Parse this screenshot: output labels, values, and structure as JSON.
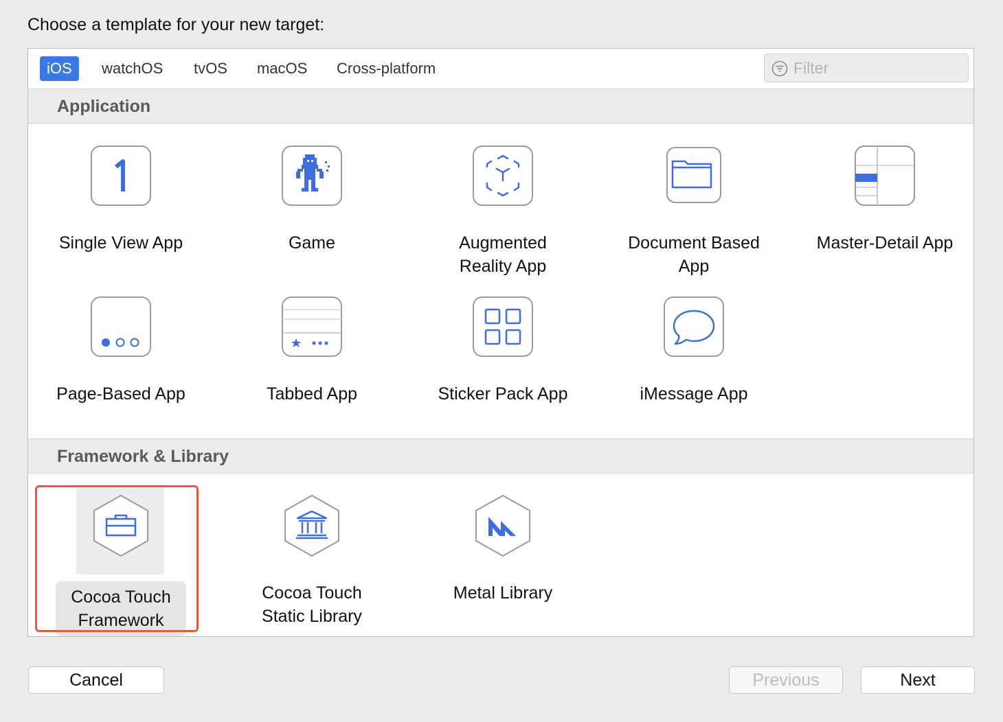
{
  "dialog": {
    "heading": "Choose a template for your new target:"
  },
  "tabs": [
    {
      "label": "iOS",
      "active": true
    },
    {
      "label": "watchOS",
      "active": false
    },
    {
      "label": "tvOS",
      "active": false
    },
    {
      "label": "macOS",
      "active": false
    },
    {
      "label": "Cross-platform",
      "active": false
    }
  ],
  "filter": {
    "placeholder": "Filter",
    "value": ""
  },
  "sections": [
    {
      "title": "Application",
      "items": [
        {
          "label": "Single View App",
          "icon": "single-view-icon"
        },
        {
          "label": "Game",
          "icon": "game-icon"
        },
        {
          "label": "Augmented\nReality App",
          "icon": "augmented-reality-icon"
        },
        {
          "label": "Document Based\nApp",
          "icon": "folder-icon"
        },
        {
          "label": "Master-Detail App",
          "icon": "master-detail-icon"
        },
        {
          "label": "Page-Based App",
          "icon": "page-dots-icon"
        },
        {
          "label": "Tabbed App",
          "icon": "tab-bar-icon"
        },
        {
          "label": "Sticker Pack App",
          "icon": "grid-icon"
        },
        {
          "label": "iMessage App",
          "icon": "speech-bubble-icon"
        }
      ]
    },
    {
      "title": "Framework & Library",
      "items": [
        {
          "label": "Cocoa Touch\nFramework",
          "icon": "toolbox-icon",
          "selected": true
        },
        {
          "label": "Cocoa Touch\nStatic Library",
          "icon": "library-building-icon"
        },
        {
          "label": "Metal Library",
          "icon": "metal-icon"
        }
      ]
    }
  ],
  "buttons": {
    "cancel": "Cancel",
    "previous": "Previous",
    "next": "Next"
  },
  "colors": {
    "accent": "#3b7ae3",
    "icon_blue": "#3d6ee0",
    "selection_outline": "#e85a3c"
  }
}
